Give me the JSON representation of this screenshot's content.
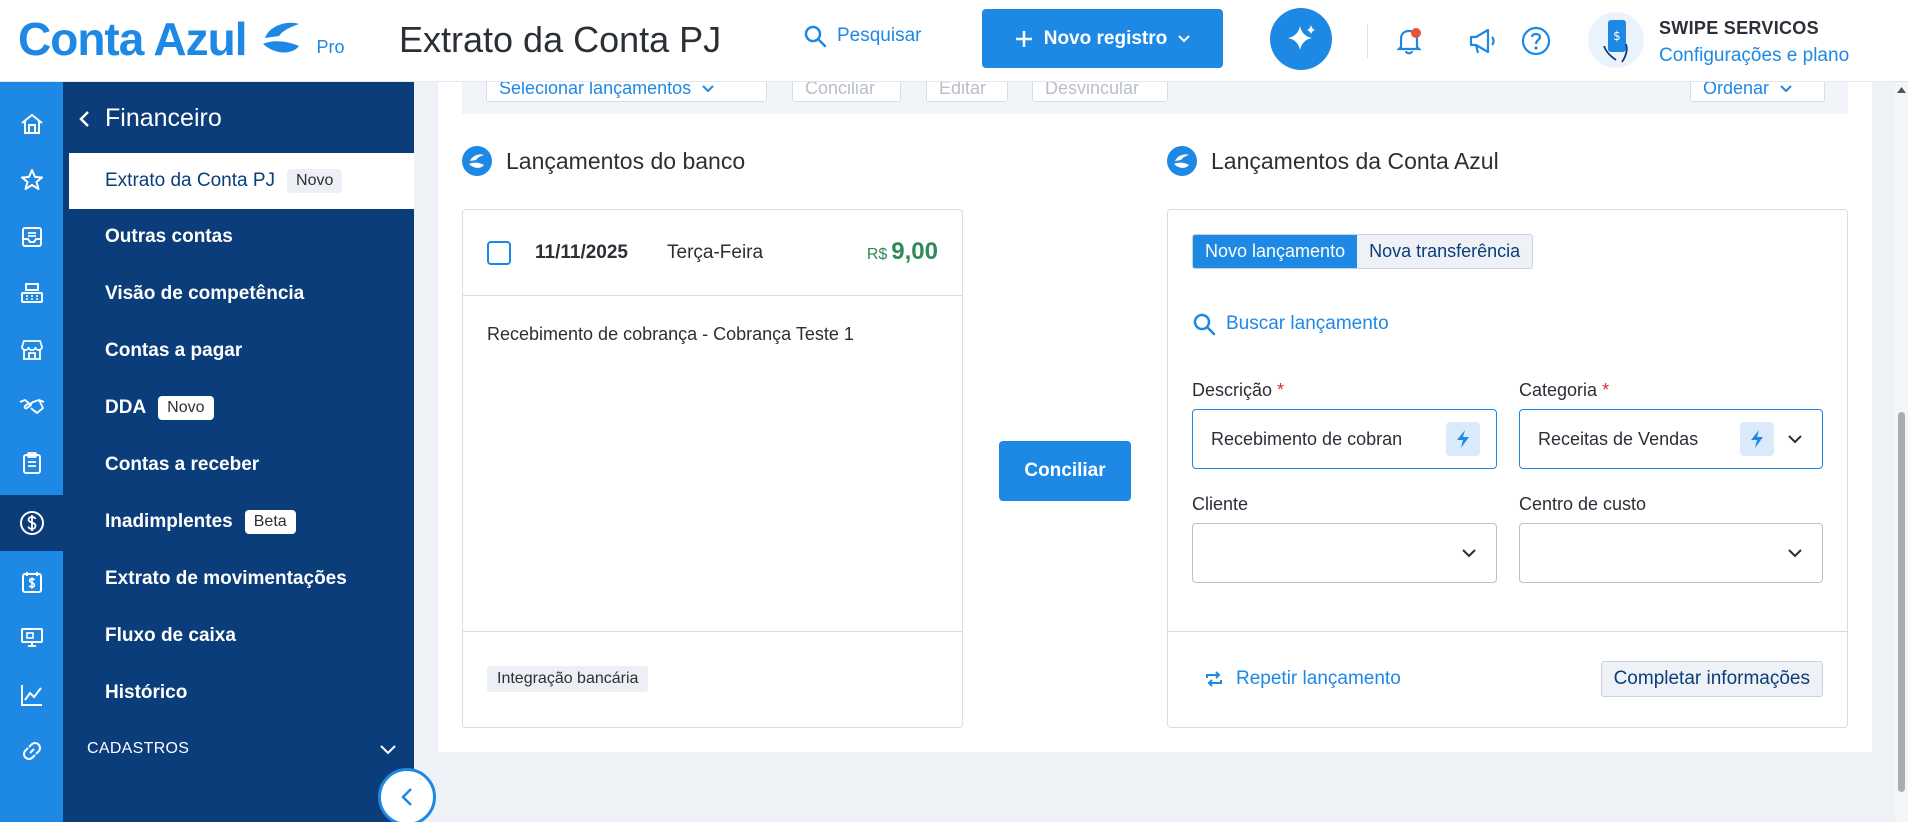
{
  "header": {
    "logo_text": "Conta Azul",
    "logo_pro": "Pro",
    "page_title": "Extrato da Conta PJ",
    "search_label": "Pesquisar",
    "new_record_label": "Novo registro",
    "company_name": "SWIPE SERVICOS",
    "company_link": "Configurações e plano"
  },
  "rail": {
    "icons": [
      "home-icon",
      "star-icon",
      "inbox-icon",
      "cash-register-icon",
      "store-icon",
      "handshake-icon",
      "clipboard-icon",
      "dollar-coin-icon",
      "calendar-dollar-icon",
      "monitor-icon",
      "chart-line-icon",
      "link-icon"
    ],
    "active_index": 7
  },
  "sidebar": {
    "title": "Financeiro",
    "items": [
      {
        "label": "Extrato da Conta PJ",
        "badge": "Novo",
        "active": true
      },
      {
        "label": "Outras contas",
        "badge": ""
      },
      {
        "label": "Visão de competência",
        "badge": ""
      },
      {
        "label": "Contas a pagar",
        "badge": ""
      },
      {
        "label": "DDA",
        "badge": "Novo"
      },
      {
        "label": "Contas a receber",
        "badge": ""
      },
      {
        "label": "Inadimplentes",
        "badge": "Beta"
      },
      {
        "label": "Extrato de movimentações",
        "badge": ""
      },
      {
        "label": "Fluxo de caixa",
        "badge": ""
      },
      {
        "label": "Histórico",
        "badge": ""
      }
    ],
    "section": "CADASTROS"
  },
  "toolbar": {
    "select_label": "Selecionar lançamentos",
    "conciliar_label": "Conciliar",
    "editar_label": "Editar",
    "desvincular_label": "Desvincular",
    "ordenar_label": "Ordenar"
  },
  "bank": {
    "section_title": "Lançamentos do banco",
    "date": "11/11/2025",
    "weekday": "Terça-Feira",
    "currency": "R$",
    "amount": "9,00",
    "description": "Recebimento de cobrança - Cobrança Teste 1",
    "tag": "Integração bancária"
  },
  "conciliar_button": "Conciliar",
  "contaazul": {
    "section_title": "Lançamentos da Conta Azul",
    "tab_new": "Novo lançamento",
    "tab_transfer": "Nova transferência",
    "search_label": "Buscar lançamento",
    "descricao_label": "Descrição",
    "descricao_value": "Recebimento de cobran",
    "categoria_label": "Categoria",
    "categoria_value": "Receitas de Vendas",
    "cliente_label": "Cliente",
    "centro_label": "Centro de custo",
    "required_mark": "*",
    "repetir_label": "Repetir lançamento",
    "completar_label": "Completar informações"
  },
  "colors": {
    "accent": "#1e88e5",
    "sidebar": "#0b3d7a",
    "amount": "#2e8b57"
  }
}
